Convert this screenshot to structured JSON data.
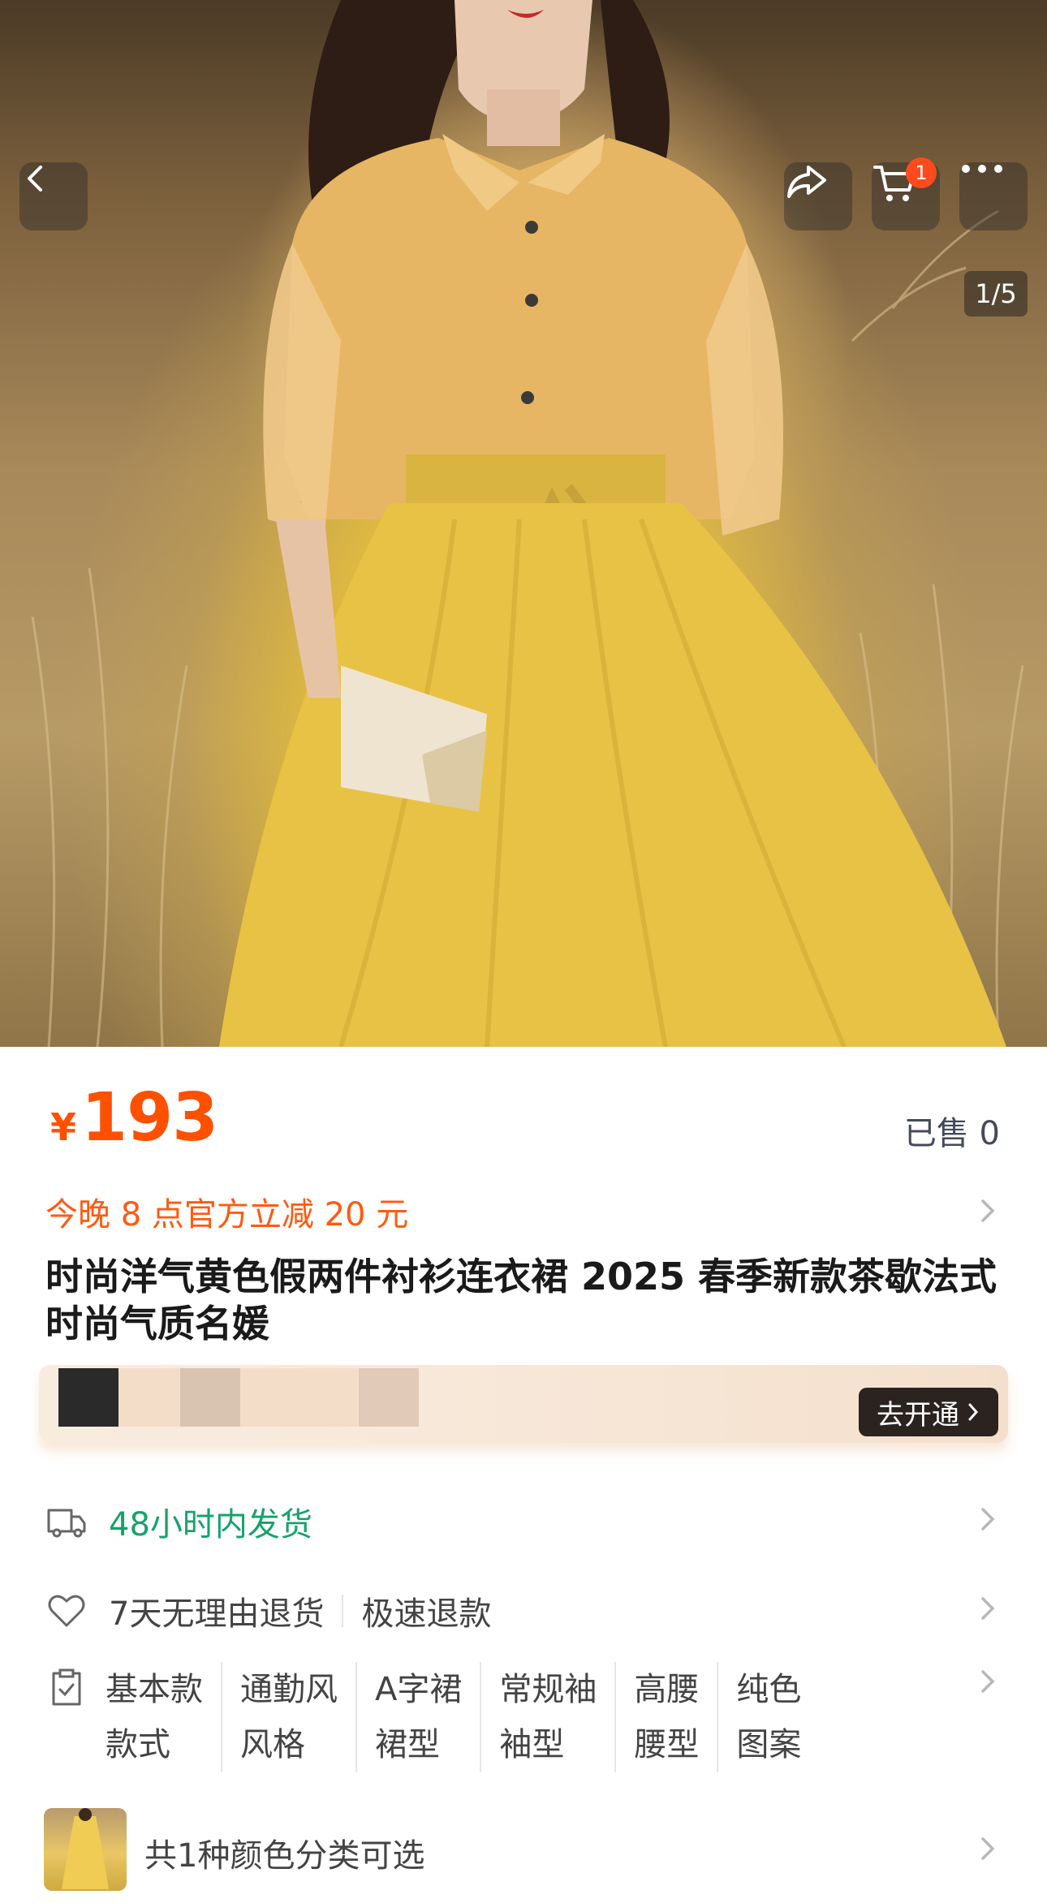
{
  "header": {
    "image_counter": "1/5",
    "cart_badge": "1",
    "icons": [
      "back-icon",
      "share-icon",
      "cart-icon",
      "more-icon"
    ]
  },
  "product": {
    "currency": "¥",
    "price": "193",
    "sold": "已售 0",
    "promo": "今晚 8 点官方立减 20 元",
    "title": "时尚洋气黄色假两件衬衫连衣裙 2025 春季新款茶歇法式时尚气质名媛"
  },
  "banner": {
    "button_label": "去开通"
  },
  "service": {
    "shipping": "48小时内发货",
    "returns": "7天无理由退货",
    "refund": "极速退款"
  },
  "attributes": [
    {
      "value": "基本款",
      "key": "款式"
    },
    {
      "value": "通勤风",
      "key": "风格"
    },
    {
      "value": "A字裙",
      "key": "裙型"
    },
    {
      "value": "常规袖",
      "key": "袖型"
    },
    {
      "value": "高腰",
      "key": "腰型"
    },
    {
      "value": "纯色",
      "key": "图案"
    }
  ],
  "variants": {
    "text": "共1种颜色分类可选"
  },
  "colors": {
    "price": "#ff5000",
    "promo": "#ff5a10",
    "shipping": "#15a36b",
    "badge": "#ff4a1d"
  }
}
